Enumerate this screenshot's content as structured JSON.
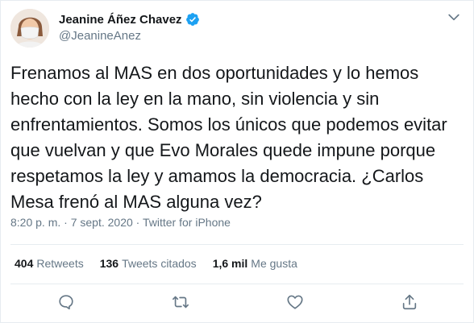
{
  "author": {
    "display_name": "Jeanine Áñez Chavez",
    "handle": "@JeanineAnez",
    "verified": true
  },
  "tweet": {
    "text": "Frenamos al MAS en dos oportunidades y lo hemos\nhecho con la ley en la mano, sin violencia y sin\nenfrentamientos. Somos los únicos que podemos evitar\nque vuelvan y que Evo Morales quede impune porque\nrespetamos la ley y amamos la democracia. ¿Carlos\nMesa frenó al MAS alguna vez?",
    "time": "8:20 p. m.",
    "separator": "·",
    "date": "7 sept. 2020",
    "source": "Twitter for iPhone"
  },
  "stats": {
    "retweets_count": "404",
    "retweets_label": "Retweets",
    "quotes_count": "136",
    "quotes_label": "Tweets citados",
    "likes_count": "1,6 mil",
    "likes_label": "Me gusta"
  },
  "icons": {
    "verified": "verified-badge-icon",
    "more": "chevron-down-icon",
    "reply": "reply-icon",
    "retweet": "retweet-icon",
    "like": "heart-icon",
    "share": "share-icon"
  },
  "colors": {
    "primary_text": "#14171a",
    "secondary_text": "#657786",
    "verified_blue": "#1da1f2",
    "divider": "#e6ecf0"
  }
}
